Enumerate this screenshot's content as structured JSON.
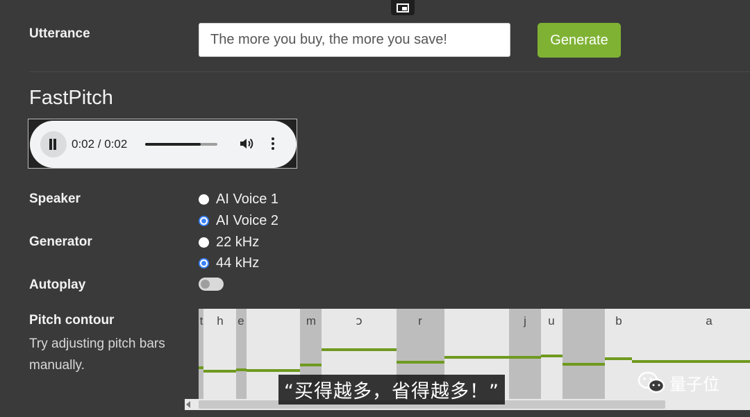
{
  "utterance": {
    "label": "Utterance",
    "value": "The more you buy, the more you save!"
  },
  "generate_label": "Generate",
  "section_title": "FastPitch",
  "audio": {
    "time": "0:02 / 0:02",
    "progress": 0.77
  },
  "speaker": {
    "label": "Speaker",
    "options": [
      "AI Voice 1",
      "AI Voice 2"
    ],
    "selected": "AI Voice 2"
  },
  "generator": {
    "label": "Generator",
    "options": [
      "22 kHz",
      "44 kHz"
    ],
    "selected": "44 kHz"
  },
  "autoplay": {
    "label": "Autoplay",
    "on": false
  },
  "pitch": {
    "label": "Pitch contour",
    "help": "Try adjusting pitch bars manually.",
    "phonemes": [
      "t",
      "h",
      "e",
      "m",
      "ɔ",
      "r",
      "j",
      "u",
      "b",
      "a"
    ]
  },
  "subtitle": "“买得越多，省得越多！”",
  "watermark": "量子位",
  "colors": {
    "accent_green": "#7fb233",
    "radio_blue": "#3b82f6",
    "pitch_bar": "#6f9a1f"
  }
}
